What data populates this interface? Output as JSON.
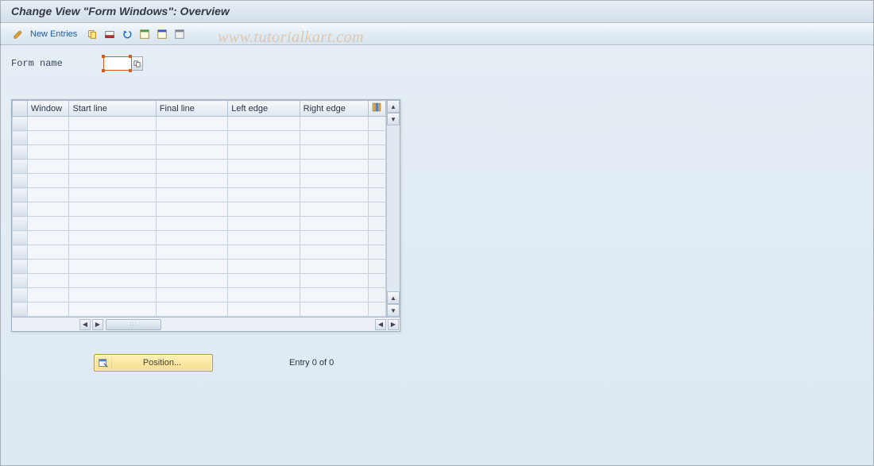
{
  "title": "Change View \"Form Windows\": Overview",
  "toolbar": {
    "new_entries": "New Entries"
  },
  "form": {
    "name_label": "Form name",
    "name_value": ""
  },
  "watermark": "www.tutorialkart.com",
  "table": {
    "columns": [
      "Window",
      "Start line",
      "Final line",
      "Left edge",
      "Right edge"
    ],
    "row_count": 14
  },
  "footer": {
    "position_label": "Position...",
    "entry_text": "Entry 0 of 0"
  }
}
